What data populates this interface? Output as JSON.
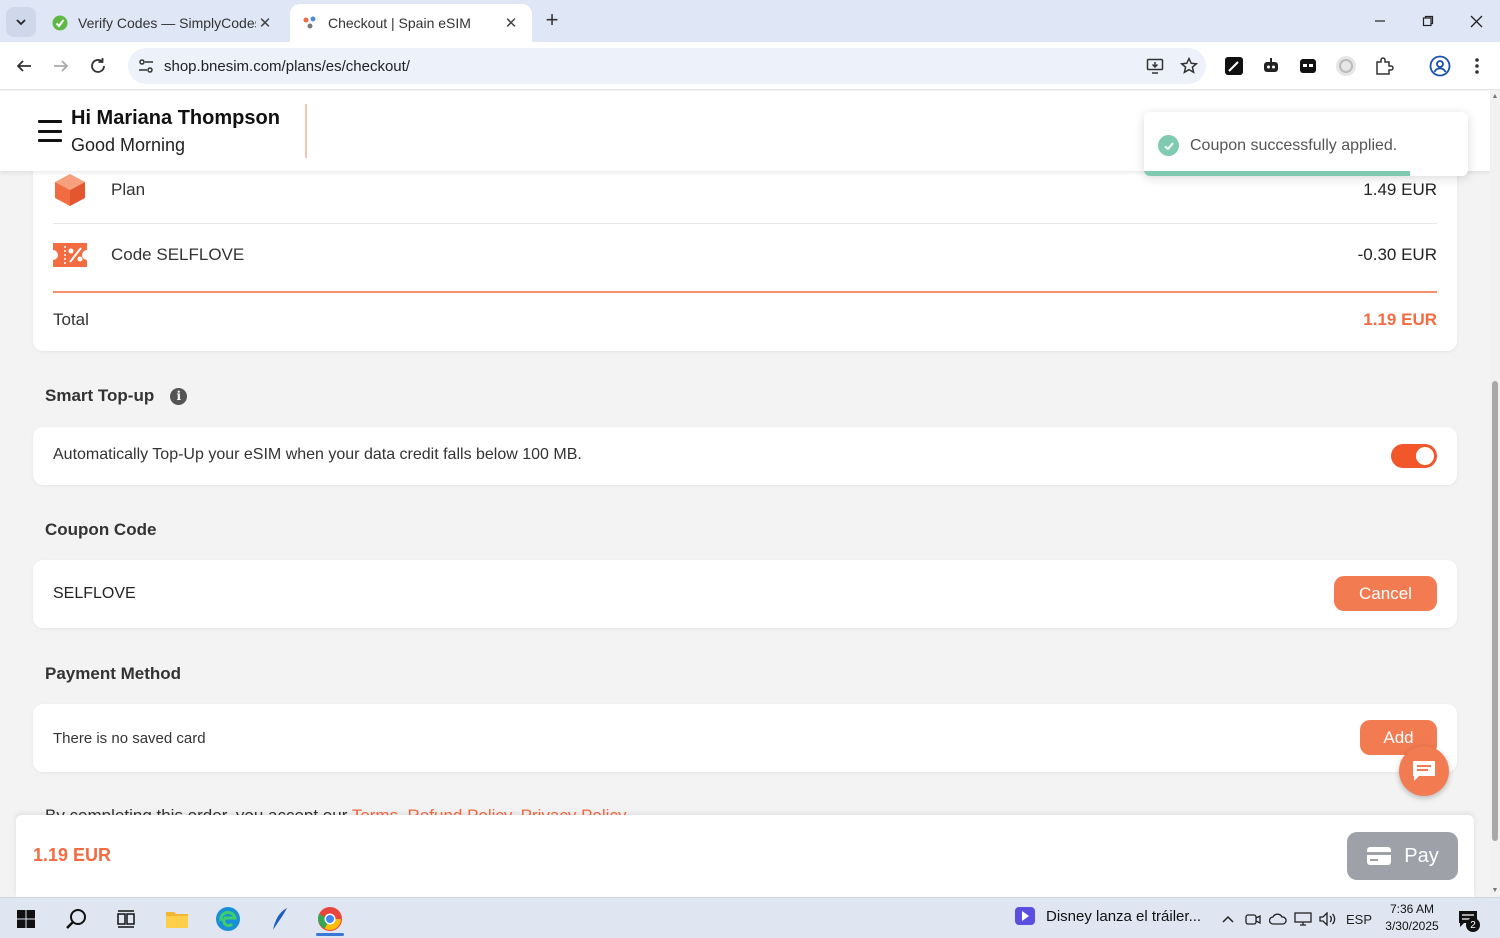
{
  "browser": {
    "tabs": [
      {
        "title": "Verify Codes — SimplyCodes",
        "active": false
      },
      {
        "title": "Checkout | Spain eSIM",
        "active": true
      }
    ],
    "url": "shop.bnesim.com/plans/es/checkout/"
  },
  "header": {
    "greeting": "Hi Mariana Thompson",
    "subgreeting": "Good Morning"
  },
  "toast": {
    "message": "Coupon successfully applied.",
    "progress": 0.82
  },
  "summary": {
    "plan_label": "Plan",
    "plan_value": "1.49 EUR",
    "coupon_label": "Code SELFLOVE",
    "coupon_value": "-0.30 EUR",
    "total_label": "Total",
    "total_value": "1.19 EUR"
  },
  "smart_topup": {
    "title": "Smart Top-up",
    "description": "Automatically Top-Up your eSIM when your data credit falls below 100 MB.",
    "enabled": true
  },
  "coupon": {
    "title": "Coupon Code",
    "code": "SELFLOVE",
    "cancel_label": "Cancel"
  },
  "payment": {
    "title": "Payment Method",
    "empty_text": "There is no saved card",
    "add_label": "Add"
  },
  "terms": {
    "prefix": "By completing this order, you accept our",
    "links": [
      "Terms,",
      "Refund Policy,",
      "Privacy Policy"
    ]
  },
  "paybar": {
    "amount": "1.19 EUR",
    "pay_label": "Pay"
  },
  "taskbar": {
    "news": "Disney lanza el tráiler...",
    "language": "ESP",
    "time": "7:36 AM",
    "date": "3/30/2025",
    "notifications": "2"
  },
  "colors": {
    "accent": "#f26b41",
    "button": "#f37b52",
    "toggle_on": "#f2562b",
    "success": "#7fcab1",
    "pay_disabled": "#9ea2a8"
  }
}
